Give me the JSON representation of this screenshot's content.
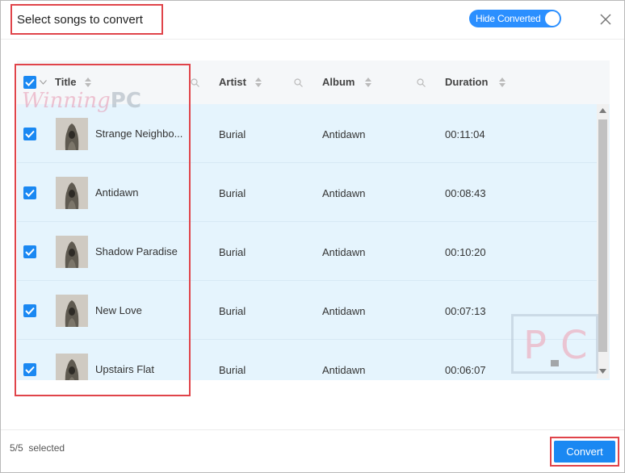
{
  "dialog": {
    "title": "Select songs to convert",
    "hide_converted_label": "Hide Converted",
    "hide_converted_on": true
  },
  "columns": {
    "title": "Title",
    "artist": "Artist",
    "album": "Album",
    "duration": "Duration"
  },
  "songs": [
    {
      "title": "Strange Neighbo...",
      "artist": "Burial",
      "album": "Antidawn",
      "duration": "00:11:04",
      "checked": true
    },
    {
      "title": "Antidawn",
      "artist": "Burial",
      "album": "Antidawn",
      "duration": "00:08:43",
      "checked": true
    },
    {
      "title": "Shadow Paradise",
      "artist": "Burial",
      "album": "Antidawn",
      "duration": "00:10:20",
      "checked": true
    },
    {
      "title": "New Love",
      "artist": "Burial",
      "album": "Antidawn",
      "duration": "00:07:13",
      "checked": true
    },
    {
      "title": "Upstairs Flat",
      "artist": "Burial",
      "album": "Antidawn",
      "duration": "00:06:07",
      "checked": true
    }
  ],
  "footer": {
    "selected_count": "5/5",
    "selected_label": "selected",
    "convert_label": "Convert"
  },
  "watermark": {
    "text_a": "Winning",
    "text_b": "PC",
    "logo_a": "P",
    "logo_b": "C"
  },
  "colors": {
    "accent": "#1a88f2",
    "row_bg": "#e5f4fd",
    "highlight": "#e0444a"
  },
  "icons": [
    "checkbox-icon",
    "chevron-down-icon",
    "sort-icon",
    "search-icon",
    "close-icon",
    "album-art-icon"
  ]
}
